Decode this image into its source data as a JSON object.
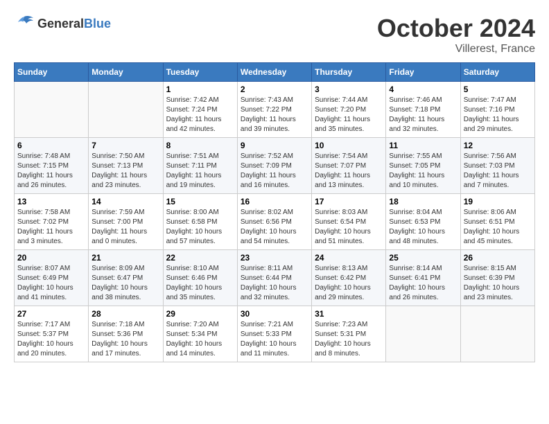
{
  "header": {
    "logo": {
      "general": "General",
      "blue": "Blue"
    },
    "title": "October 2024",
    "location": "Villerest, France"
  },
  "calendar": {
    "weekdays": [
      "Sunday",
      "Monday",
      "Tuesday",
      "Wednesday",
      "Thursday",
      "Friday",
      "Saturday"
    ],
    "weeks": [
      [
        {
          "day": "",
          "sunrise": "",
          "sunset": "",
          "daylight": ""
        },
        {
          "day": "",
          "sunrise": "",
          "sunset": "",
          "daylight": ""
        },
        {
          "day": "1",
          "sunrise": "Sunrise: 7:42 AM",
          "sunset": "Sunset: 7:24 PM",
          "daylight": "Daylight: 11 hours and 42 minutes."
        },
        {
          "day": "2",
          "sunrise": "Sunrise: 7:43 AM",
          "sunset": "Sunset: 7:22 PM",
          "daylight": "Daylight: 11 hours and 39 minutes."
        },
        {
          "day": "3",
          "sunrise": "Sunrise: 7:44 AM",
          "sunset": "Sunset: 7:20 PM",
          "daylight": "Daylight: 11 hours and 35 minutes."
        },
        {
          "day": "4",
          "sunrise": "Sunrise: 7:46 AM",
          "sunset": "Sunset: 7:18 PM",
          "daylight": "Daylight: 11 hours and 32 minutes."
        },
        {
          "day": "5",
          "sunrise": "Sunrise: 7:47 AM",
          "sunset": "Sunset: 7:16 PM",
          "daylight": "Daylight: 11 hours and 29 minutes."
        }
      ],
      [
        {
          "day": "6",
          "sunrise": "Sunrise: 7:48 AM",
          "sunset": "Sunset: 7:15 PM",
          "daylight": "Daylight: 11 hours and 26 minutes."
        },
        {
          "day": "7",
          "sunrise": "Sunrise: 7:50 AM",
          "sunset": "Sunset: 7:13 PM",
          "daylight": "Daylight: 11 hours and 23 minutes."
        },
        {
          "day": "8",
          "sunrise": "Sunrise: 7:51 AM",
          "sunset": "Sunset: 7:11 PM",
          "daylight": "Daylight: 11 hours and 19 minutes."
        },
        {
          "day": "9",
          "sunrise": "Sunrise: 7:52 AM",
          "sunset": "Sunset: 7:09 PM",
          "daylight": "Daylight: 11 hours and 16 minutes."
        },
        {
          "day": "10",
          "sunrise": "Sunrise: 7:54 AM",
          "sunset": "Sunset: 7:07 PM",
          "daylight": "Daylight: 11 hours and 13 minutes."
        },
        {
          "day": "11",
          "sunrise": "Sunrise: 7:55 AM",
          "sunset": "Sunset: 7:05 PM",
          "daylight": "Daylight: 11 hours and 10 minutes."
        },
        {
          "day": "12",
          "sunrise": "Sunrise: 7:56 AM",
          "sunset": "Sunset: 7:03 PM",
          "daylight": "Daylight: 11 hours and 7 minutes."
        }
      ],
      [
        {
          "day": "13",
          "sunrise": "Sunrise: 7:58 AM",
          "sunset": "Sunset: 7:02 PM",
          "daylight": "Daylight: 11 hours and 3 minutes."
        },
        {
          "day": "14",
          "sunrise": "Sunrise: 7:59 AM",
          "sunset": "Sunset: 7:00 PM",
          "daylight": "Daylight: 11 hours and 0 minutes."
        },
        {
          "day": "15",
          "sunrise": "Sunrise: 8:00 AM",
          "sunset": "Sunset: 6:58 PM",
          "daylight": "Daylight: 10 hours and 57 minutes."
        },
        {
          "day": "16",
          "sunrise": "Sunrise: 8:02 AM",
          "sunset": "Sunset: 6:56 PM",
          "daylight": "Daylight: 10 hours and 54 minutes."
        },
        {
          "day": "17",
          "sunrise": "Sunrise: 8:03 AM",
          "sunset": "Sunset: 6:54 PM",
          "daylight": "Daylight: 10 hours and 51 minutes."
        },
        {
          "day": "18",
          "sunrise": "Sunrise: 8:04 AM",
          "sunset": "Sunset: 6:53 PM",
          "daylight": "Daylight: 10 hours and 48 minutes."
        },
        {
          "day": "19",
          "sunrise": "Sunrise: 8:06 AM",
          "sunset": "Sunset: 6:51 PM",
          "daylight": "Daylight: 10 hours and 45 minutes."
        }
      ],
      [
        {
          "day": "20",
          "sunrise": "Sunrise: 8:07 AM",
          "sunset": "Sunset: 6:49 PM",
          "daylight": "Daylight: 10 hours and 41 minutes."
        },
        {
          "day": "21",
          "sunrise": "Sunrise: 8:09 AM",
          "sunset": "Sunset: 6:47 PM",
          "daylight": "Daylight: 10 hours and 38 minutes."
        },
        {
          "day": "22",
          "sunrise": "Sunrise: 8:10 AM",
          "sunset": "Sunset: 6:46 PM",
          "daylight": "Daylight: 10 hours and 35 minutes."
        },
        {
          "day": "23",
          "sunrise": "Sunrise: 8:11 AM",
          "sunset": "Sunset: 6:44 PM",
          "daylight": "Daylight: 10 hours and 32 minutes."
        },
        {
          "day": "24",
          "sunrise": "Sunrise: 8:13 AM",
          "sunset": "Sunset: 6:42 PM",
          "daylight": "Daylight: 10 hours and 29 minutes."
        },
        {
          "day": "25",
          "sunrise": "Sunrise: 8:14 AM",
          "sunset": "Sunset: 6:41 PM",
          "daylight": "Daylight: 10 hours and 26 minutes."
        },
        {
          "day": "26",
          "sunrise": "Sunrise: 8:15 AM",
          "sunset": "Sunset: 6:39 PM",
          "daylight": "Daylight: 10 hours and 23 minutes."
        }
      ],
      [
        {
          "day": "27",
          "sunrise": "Sunrise: 7:17 AM",
          "sunset": "Sunset: 5:37 PM",
          "daylight": "Daylight: 10 hours and 20 minutes."
        },
        {
          "day": "28",
          "sunrise": "Sunrise: 7:18 AM",
          "sunset": "Sunset: 5:36 PM",
          "daylight": "Daylight: 10 hours and 17 minutes."
        },
        {
          "day": "29",
          "sunrise": "Sunrise: 7:20 AM",
          "sunset": "Sunset: 5:34 PM",
          "daylight": "Daylight: 10 hours and 14 minutes."
        },
        {
          "day": "30",
          "sunrise": "Sunrise: 7:21 AM",
          "sunset": "Sunset: 5:33 PM",
          "daylight": "Daylight: 10 hours and 11 minutes."
        },
        {
          "day": "31",
          "sunrise": "Sunrise: 7:23 AM",
          "sunset": "Sunset: 5:31 PM",
          "daylight": "Daylight: 10 hours and 8 minutes."
        },
        {
          "day": "",
          "sunrise": "",
          "sunset": "",
          "daylight": ""
        },
        {
          "day": "",
          "sunrise": "",
          "sunset": "",
          "daylight": ""
        }
      ]
    ]
  }
}
